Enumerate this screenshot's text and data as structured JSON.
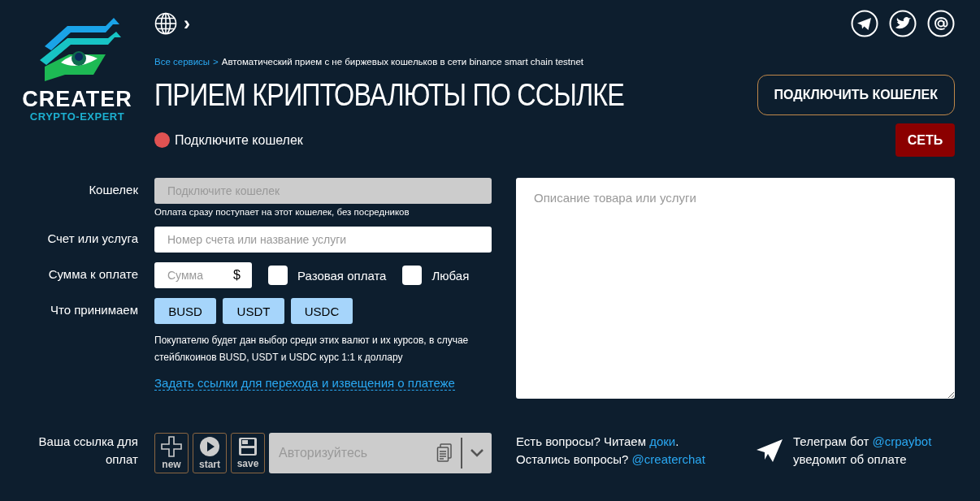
{
  "logo": {
    "name": "CREATER",
    "tagline": "CRYPTO-EXPERT"
  },
  "language_chevron": "›",
  "breadcrumb": {
    "link": "Все сервисы",
    "separator": ">",
    "current": "Автоматический прием с не биржевых кошельков в сети binance smart chain testnet"
  },
  "title": "ПРИЕМ КРИПТОВАЛЮТЫ ПО ССЫЛКЕ",
  "connect_button": "ПОДКЛЮЧИТЬ КОШЕЛЕК",
  "status": {
    "connected": false,
    "text": "Подключите кошелек"
  },
  "network_button": "СЕТЬ",
  "form": {
    "wallet": {
      "label": "Кошелек",
      "placeholder": "Подключите кошелек",
      "disabled": true,
      "hint": "Оплата сразу поступает на этот кошелек, без посредников"
    },
    "invoice": {
      "label": "Счет или услуга",
      "placeholder": "Номер счета или название услуги"
    },
    "amount": {
      "label": "Сумма к оплате",
      "placeholder": "Сумма",
      "currency": "$",
      "options": [
        {
          "label": "Разовая оплата",
          "checked": false
        },
        {
          "label": "Любая",
          "checked": false
        }
      ]
    },
    "accept": {
      "label": "Что принимаем",
      "currencies": [
        {
          "label": "BUSD",
          "selected": true
        },
        {
          "label": "USDT",
          "selected": true
        },
        {
          "label": "USDC",
          "selected": true
        }
      ],
      "hint": "Покупателю будет дан выбор среди этих валют и их курсов, в случае стейблкоинов BUSD, USDT и USDC курс 1:1 к доллару"
    },
    "links_toggle": "Задать ссылки для перехода и извещения о платеже",
    "description": {
      "placeholder": "Описание товара или услуги"
    }
  },
  "link_row": {
    "label": "Ваша ссылка для оплат",
    "actions": [
      {
        "kind": "new",
        "label": "new"
      },
      {
        "kind": "start",
        "label": "start"
      },
      {
        "kind": "save",
        "label": "save"
      }
    ],
    "placeholder": "Авторизуйтесь"
  },
  "help": {
    "line1_text": "Есть вопросы? Читаем",
    "line1_link": "доки",
    "line1_end": ".",
    "line2_text": "Остались вопросы?",
    "line2_link": "@createrchat"
  },
  "bot": {
    "text": "Телеграм бот",
    "link": "@crpaybot",
    "line2": "уведомит об оплате"
  }
}
